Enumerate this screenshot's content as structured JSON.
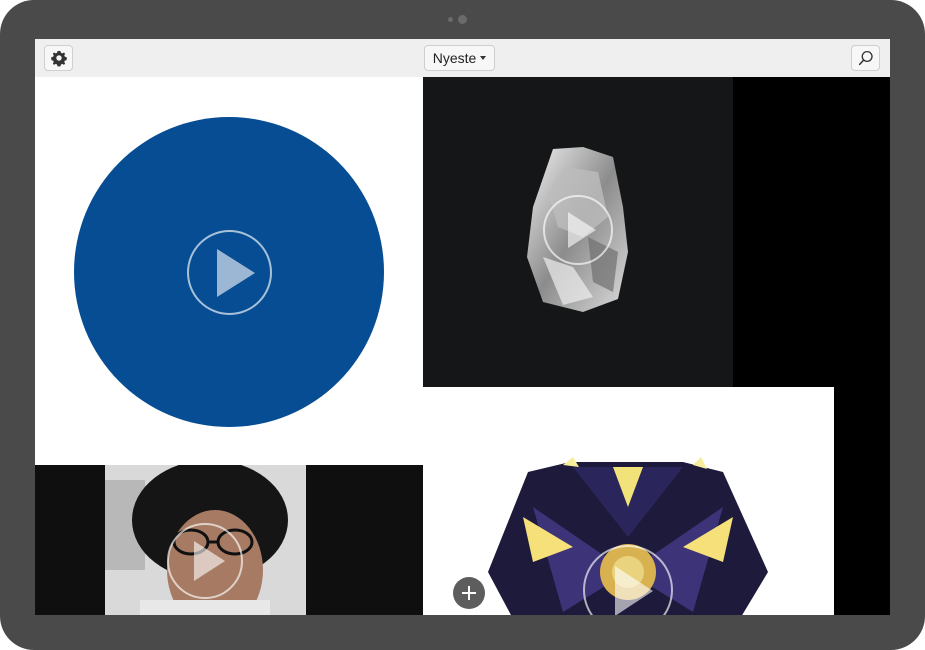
{
  "toolbar": {
    "settings_icon": "gear-icon",
    "sort_label": "Nyeste",
    "sort_icon": "caret-down-icon",
    "search_icon": "search-icon"
  },
  "colors": {
    "device_frame": "#4a4a4a",
    "toolbar_bg": "#efefef",
    "blue_tile": "#064d93",
    "add_button": "#5d5d5d"
  },
  "grid": {
    "tiles": [
      {
        "name": "blue-circle-video",
        "media": "video",
        "icon": "play-icon"
      },
      {
        "name": "crystal-video",
        "media": "video",
        "icon": "play-icon"
      },
      {
        "name": "portrait-video",
        "media": "video",
        "icon": "play-icon"
      },
      {
        "name": "kaleidoscope-video",
        "media": "video",
        "icon": "play-icon"
      }
    ]
  },
  "actions": {
    "add_icon": "plus-icon"
  }
}
